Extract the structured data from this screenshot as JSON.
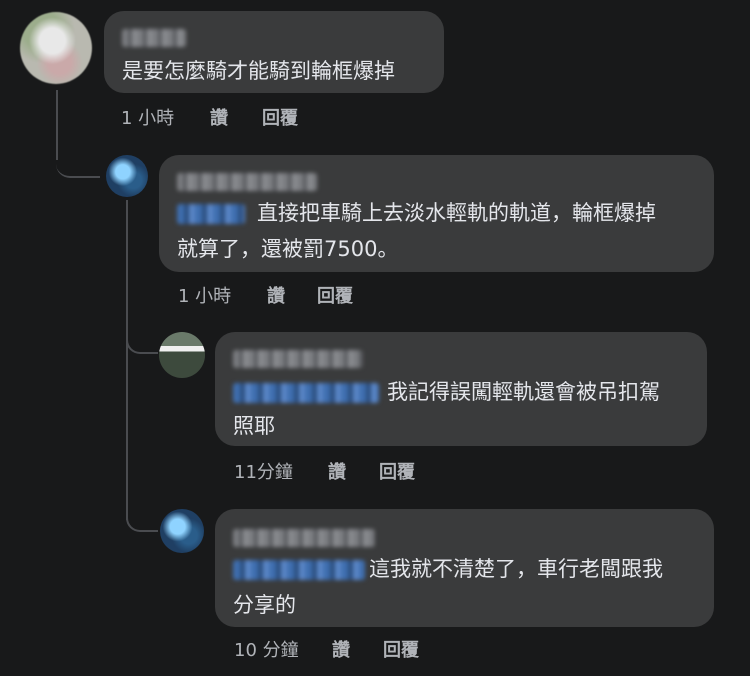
{
  "comments": [
    {
      "text": "是要怎麼騎才能騎到輪框爆掉",
      "time": "1 小時",
      "like": "讚",
      "reply": "回覆"
    },
    {
      "text_line1": "直接把車騎上去淡水輕軌的軌道，輪框爆掉",
      "text_line2": "就算了，還被罰7500。",
      "time": "1 小時",
      "like": "讚",
      "reply": "回覆"
    },
    {
      "text_line1": "我記得誤闖輕軌還會被吊扣駕",
      "text_line2": "照耶",
      "time": "11分鐘",
      "like": "讚",
      "reply": "回覆"
    },
    {
      "text_line1": "這我就不清楚了，車行老闆跟我",
      "text_line2": "分享的",
      "time": "10 分鐘",
      "like": "讚",
      "reply": "回覆"
    }
  ],
  "colors": {
    "background": "#18191a",
    "bubble": "#3a3b3c",
    "text": "#e4e6eb",
    "meta": "#b0b3b8",
    "mention": "#3f6fb0"
  }
}
